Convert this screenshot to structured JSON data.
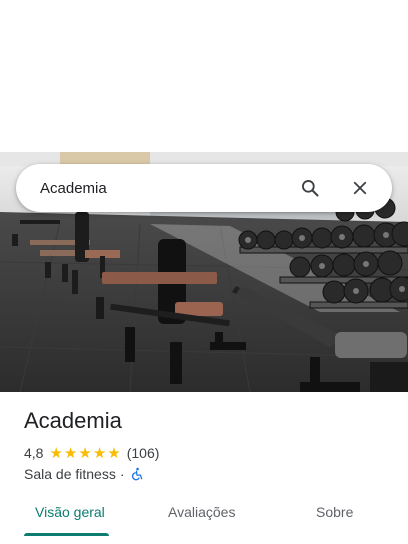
{
  "search": {
    "query": "Academia"
  },
  "icons": {
    "search": "search-icon",
    "close": "close-icon",
    "accessibility": "wheelchair-icon",
    "star": "star-icon"
  },
  "place": {
    "name": "Academia",
    "rating": "4,8",
    "rating_stars": 5,
    "reviews": "(106)",
    "category": "Sala de fitness",
    "separator": "·"
  },
  "tabs": [
    {
      "label": "Visão geral",
      "active": true
    },
    {
      "label": "Avaliações",
      "active": false
    },
    {
      "label": "Sobre",
      "active": false
    }
  ],
  "colors": {
    "accent": "#0b7c70",
    "star": "#fbbc04",
    "wheelchair": "#1a73e8"
  }
}
